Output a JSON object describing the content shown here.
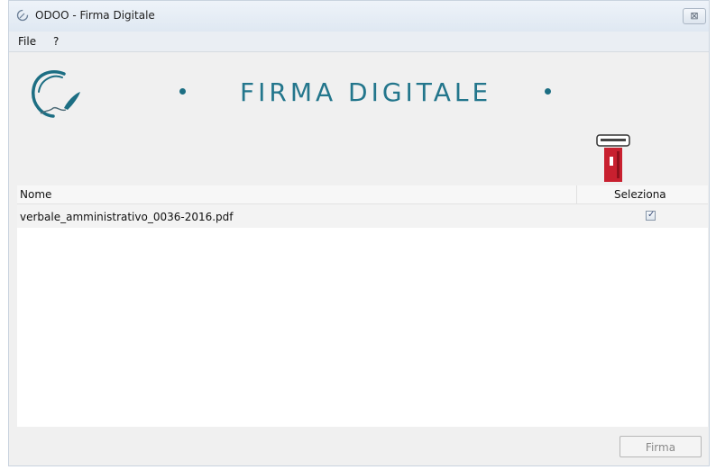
{
  "window": {
    "title": "ODOO - Firma Digitale",
    "close_glyph": "⊠"
  },
  "menu": {
    "items": [
      "File",
      "?"
    ]
  },
  "banner": {
    "title": "FIRMA DIGITALE",
    "accent_color": "#23768c"
  },
  "table": {
    "columns": [
      "Nome",
      "Seleziona"
    ],
    "rows": [
      {
        "name": "verbale_amministrativo_0036-2016.pdf",
        "selected": true
      }
    ]
  },
  "footer": {
    "sign_button": "Firma"
  },
  "icons": [
    "app-icon",
    "feather-logo-icon",
    "smartcard-reader-icon",
    "checkmark-icon"
  ]
}
